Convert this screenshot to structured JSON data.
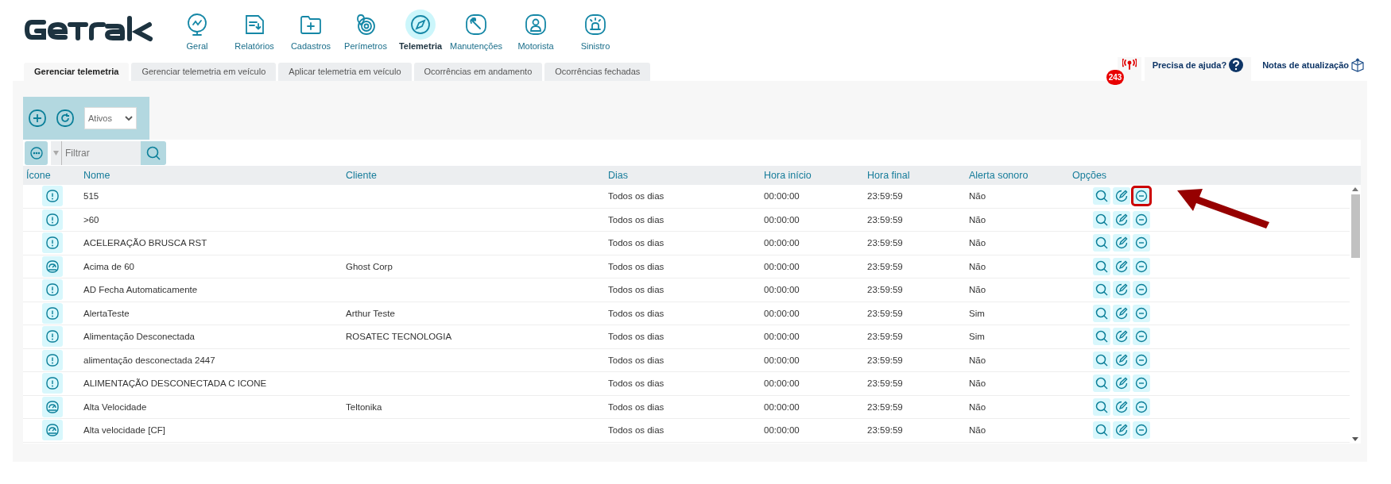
{
  "nav": [
    {
      "label": "Geral",
      "selected": false
    },
    {
      "label": "Relatórios",
      "selected": false
    },
    {
      "label": "Cadastros",
      "selected": false
    },
    {
      "label": "Perímetros",
      "selected": false
    },
    {
      "label": "Telemetria",
      "selected": true
    },
    {
      "label": "Manutenções",
      "selected": false
    },
    {
      "label": "Motorista",
      "selected": false
    },
    {
      "label": "Sinistro",
      "selected": false
    }
  ],
  "tabs": [
    {
      "label": "Gerenciar telemetria",
      "selected": true
    },
    {
      "label": "Gerenciar telemetria em veículo",
      "selected": false
    },
    {
      "label": "Aplicar telemetria em veículo",
      "selected": false
    },
    {
      "label": "Ocorrências em andamento",
      "selected": false
    },
    {
      "label": "Ocorrências fechadas",
      "selected": false
    }
  ],
  "alerts_badge": "243",
  "help_link": "Precisa de ajuda?",
  "release_notes_link": "Notas de atualização",
  "toolbar": {
    "status_select": "Ativos",
    "filter_placeholder": "Filtrar"
  },
  "table": {
    "columns": [
      "Ícone",
      "Nome",
      "Cliente",
      "Dias",
      "Hora início",
      "Hora final",
      "Alerta sonoro",
      "Opções"
    ],
    "rows": [
      {
        "kind": "alert",
        "name": "515",
        "days": "Todos os dias",
        "start": "00:00:00",
        "end": "23:59:59",
        "sound": "Não",
        "highlighted": true
      },
      {
        "kind": "alert",
        "name": ">60",
        "days": "Todos os dias",
        "start": "00:00:00",
        "end": "23:59:59",
        "sound": "Não",
        "highlighted": false
      },
      {
        "kind": "alert",
        "name": "ACELERAÇÃO BRUSCA RST",
        "days": "Todos os dias",
        "start": "00:00:00",
        "end": "23:59:59",
        "sound": "Não",
        "highlighted": false
      },
      {
        "kind": "gauge",
        "name": "Acima de 60",
        "client": "Ghost Corp",
        "days": "Todos os dias",
        "start": "00:00:00",
        "end": "23:59:59",
        "sound": "Não",
        "highlighted": false
      },
      {
        "kind": "alert",
        "name": "AD Fecha Automaticamente",
        "days": "Todos os dias",
        "start": "00:00:00",
        "end": "23:59:59",
        "sound": "Não",
        "highlighted": false
      },
      {
        "kind": "alert",
        "name": "AlertaTeste",
        "client": "Arthur Teste",
        "days": "Todos os dias",
        "start": "00:00:00",
        "end": "23:59:59",
        "sound": "Sim",
        "highlighted": false
      },
      {
        "kind": "alert",
        "name": "Alimentação Desconectada",
        "client": "ROSATEC TECNOLOGIA",
        "days": "Todos os dias",
        "start": "00:00:00",
        "end": "23:59:59",
        "sound": "Sim",
        "highlighted": false
      },
      {
        "kind": "alert",
        "name": "alimentação desconectada 2447",
        "days": "Todos os dias",
        "start": "00:00:00",
        "end": "23:59:59",
        "sound": "Não",
        "highlighted": false
      },
      {
        "kind": "alert",
        "name": "ALIMENTAÇÃO DESCONECTADA C ICONE",
        "days": "Todos os dias",
        "start": "00:00:00",
        "end": "23:59:59",
        "sound": "Não",
        "highlighted": false
      },
      {
        "kind": "gauge",
        "name": "Alta Velocidade",
        "client": "Teltonika",
        "days": "Todos os dias",
        "start": "00:00:00",
        "end": "23:59:59",
        "sound": "Não",
        "highlighted": false
      },
      {
        "kind": "gauge",
        "name": "Alta velocidade [CF]",
        "days": "Todos os dias",
        "start": "00:00:00",
        "end": "23:59:59",
        "sound": "Não",
        "highlighted": false
      }
    ]
  }
}
